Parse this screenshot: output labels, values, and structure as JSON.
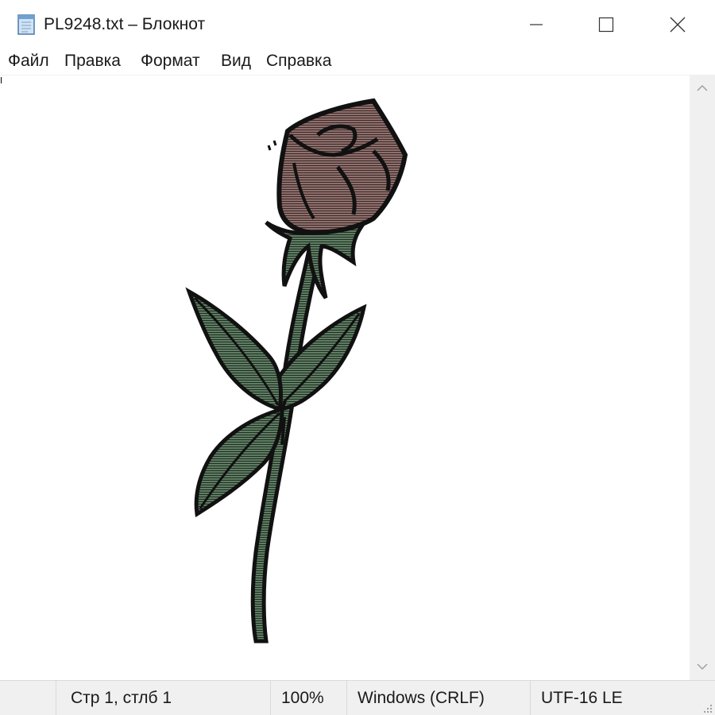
{
  "window": {
    "title": "PL9248.txt – Блокнот"
  },
  "menu": {
    "items": [
      "Файл",
      "Правка",
      "Формат",
      "Вид",
      "Справка"
    ]
  },
  "editor": {
    "content_description_icon": "rose-ascii-art"
  },
  "status": {
    "position": "Стр 1, стлб 1",
    "zoom": "100%",
    "line_ending": "Windows (CRLF)",
    "encoding": "UTF-16 LE"
  },
  "colors": {
    "petal": "#8e6f6c",
    "leaf": "#5f7d63",
    "outline": "#111111",
    "statusbar_bg": "#f0f0f0"
  }
}
